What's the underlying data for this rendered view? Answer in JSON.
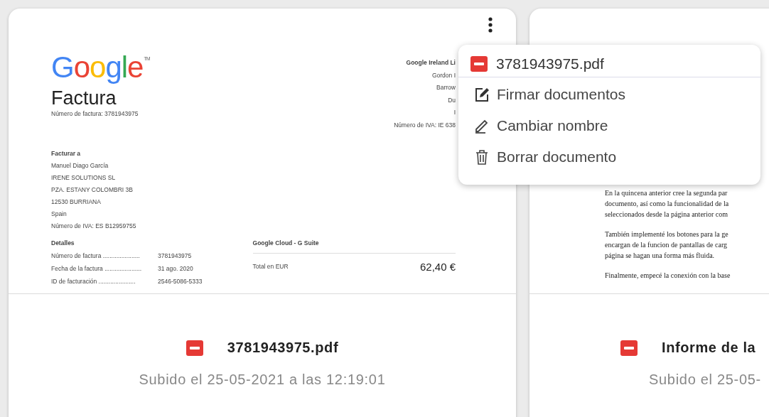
{
  "cards": [
    {
      "preview": {
        "kind": "invoice",
        "logo": {
          "text": "Google",
          "mark": "TM"
        },
        "title": "Factura",
        "invoice_number": "Número de factura: 3781943975",
        "company": [
          "Google Ireland Li",
          "Gordon I",
          "Barrow",
          "Du",
          "I",
          "Número de IVA: IE 638"
        ],
        "bill_to_heading": "Facturar a",
        "bill_to": [
          "Manuel Diago García",
          "IRENE SOLUTIONS SL",
          "PZA. ESTANY COLOMBRI 3B",
          "12530 BURRIANA",
          "Spain",
          "Número de IVA: ES B12959755"
        ],
        "details_heading": "Detalles",
        "details": [
          {
            "label": "Número de factura ......................",
            "value": "3781943975"
          },
          {
            "label": "Fecha de la factura ......................",
            "value": "31 ago. 2020"
          },
          {
            "label": "ID de facturación ......................",
            "value": "2546-5086-5333"
          }
        ],
        "product": "Google Cloud - G Suite",
        "total_label": "Total en EUR",
        "total": "62,40 €"
      },
      "file_name": "3781943975.pdf",
      "uploaded": "Subido el 25-05-2021 a las 12:19:01",
      "has_menu_button": true
    },
    {
      "preview": {
        "kind": "report",
        "paragraphs": [
          [
            "En la quincena anterior cree la segunda par",
            "documento, así como la funcionalidad de la",
            "seleccionados desde la página anterior com"
          ],
          [
            "También implementé los botones para la ge",
            "encargan de la funcion de pantallas de carg",
            "página se hagan una forma más fluida."
          ],
          [
            "Finalmente, empecé la conexión con la base"
          ]
        ]
      },
      "file_name": "Informe de la",
      "uploaded": "Subido el 25-05-",
      "has_menu_button": false
    }
  ],
  "menu": {
    "title": "3781943975.pdf",
    "items": [
      {
        "kind": "sign",
        "label": "Firmar documentos"
      },
      {
        "kind": "rename",
        "label": "Cambiar nombre"
      },
      {
        "kind": "delete",
        "label": "Borrar documento"
      }
    ]
  }
}
